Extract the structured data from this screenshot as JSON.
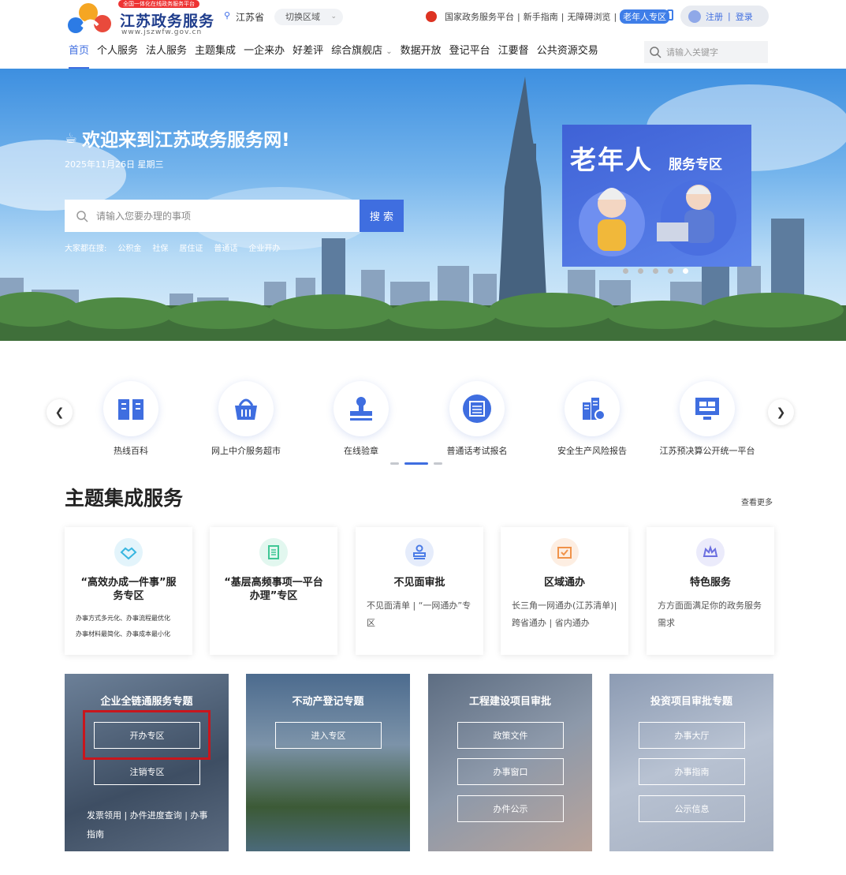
{
  "header": {
    "logo_badge": "全国一体化在线政务服务平台",
    "logo_title": "江苏政务服务",
    "logo_url": "www.jszwfw.gov.cn",
    "location": "江苏省",
    "switch_region": "切换区域",
    "links": [
      "国家政务服务平台",
      "新手指南",
      "无障碍浏览"
    ],
    "elder_zone": "老年人专区",
    "register": "注册",
    "login": "登录"
  },
  "nav": {
    "items": [
      "首页",
      "个人服务",
      "法人服务",
      "主题集成",
      "一企来办",
      "好差评",
      "综合旗舰店",
      "数据开放",
      "登记平台",
      "江要督",
      "公共资源交易"
    ],
    "dropdown_item": "综合旗舰店",
    "search_placeholder": "请输入关键字"
  },
  "hero": {
    "welcome": "欢迎来到江苏政务服务网!",
    "date": "2025年11月26日 星期三",
    "search_placeholder": "请输入您要办理的事项",
    "search_button": "搜 索",
    "hot_label": "大家都在搜:",
    "hot_terms": [
      "公积金",
      "社保",
      "居住证",
      "普通话",
      "企业开办"
    ],
    "banner_title": "老年人",
    "banner_sub": "服务专区",
    "slide_count": 5,
    "active_slide": 5
  },
  "quick_services": [
    "热线百科",
    "网上中介服务超市",
    "在线验章",
    "普通话考试报名",
    "安全生产风险报告",
    "江苏预决算公开统一平台"
  ],
  "theme": {
    "title": "主题集成服务",
    "more": "查看更多",
    "cards": [
      {
        "title": "“高效办成一件事”服务专区",
        "desc": [
          "办事方式多元化、办事流程最优化",
          "办事材料最简化、办事成本最小化"
        ],
        "icon": "handshake-icon",
        "color": "#38b6e0"
      },
      {
        "title": "“基层高频事项一平台办理”专区",
        "desc": [],
        "icon": "document-icon",
        "color": "#3fc795"
      },
      {
        "title": "不见面审批",
        "desc": [
          "不见面清单 | “一网通办”专区"
        ],
        "icon": "stamp-icon",
        "color": "#4a7be6"
      },
      {
        "title": "区域通办",
        "desc": [
          "长三角一网通办(江苏清单)| 跨省通办 | 省内通办"
        ],
        "icon": "check-mail-icon",
        "color": "#f0934a"
      },
      {
        "title": "特色服务",
        "desc": [
          "方方面面满足你的政务服务需求"
        ],
        "icon": "crown-icon",
        "color": "#6b6fe0"
      }
    ]
  },
  "topics": [
    {
      "title": "企业全链通服务专题",
      "buttons": [
        "开办专区",
        "注销专区"
      ],
      "links": "发票领用 | 办件进度查询 | 办事指南"
    },
    {
      "title": "不动产登记专题",
      "buttons": [
        "进入专区"
      ],
      "links": ""
    },
    {
      "title": "工程建设项目审批",
      "buttons": [
        "政策文件",
        "办事窗口",
        "办件公示"
      ],
      "links": ""
    },
    {
      "title": "投资项目审批专题",
      "buttons": [
        "办事大厅",
        "办事指南",
        "公示信息"
      ],
      "links": ""
    }
  ],
  "colors": {
    "brand": "#3f6ee0",
    "highlight": "#c8161d"
  }
}
